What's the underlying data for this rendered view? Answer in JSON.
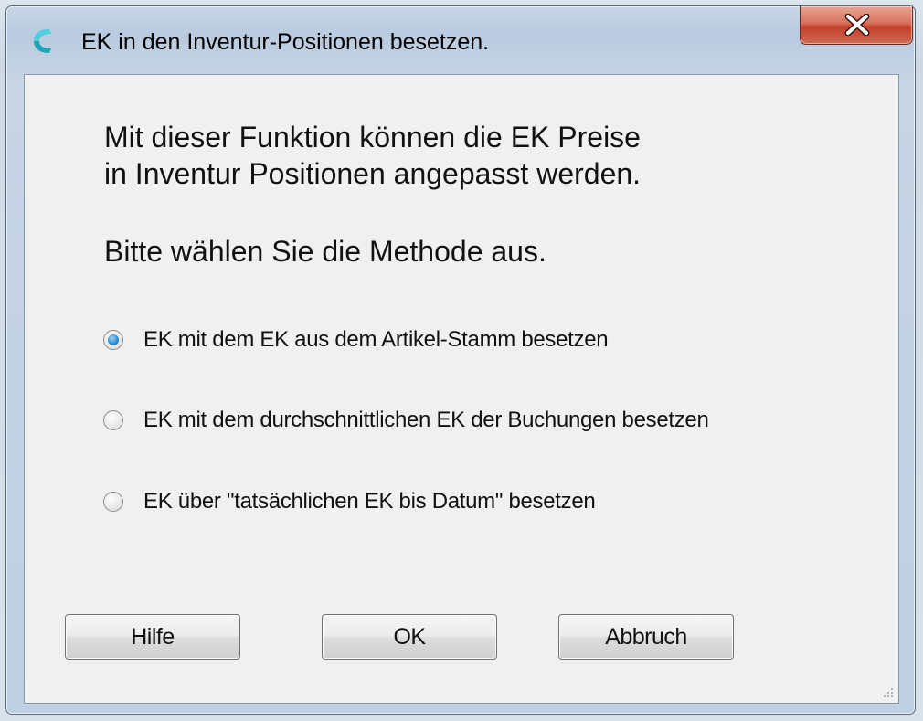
{
  "window": {
    "title": "EK in den Inventur-Positionen besetzen.",
    "close_glyph": "X",
    "accent_color": "#1fa6b6",
    "close_color": "#c8452f"
  },
  "content": {
    "intro_line1": "Mit dieser Funktion können die EK Preise",
    "intro_line2": "in Inventur Positionen angepasst werden.",
    "prompt": "Bitte wählen Sie die Methode aus."
  },
  "options": [
    {
      "label": "EK mit dem EK aus dem Artikel-Stamm besetzen",
      "checked": true
    },
    {
      "label": "EK mit dem durchschnittlichen EK der Buchungen besetzen",
      "checked": false
    },
    {
      "label": "EK über \"tatsächlichen EK bis Datum\" besetzen",
      "checked": false
    }
  ],
  "buttons": {
    "help": "Hilfe",
    "ok": "OK",
    "cancel": "Abbruch"
  }
}
